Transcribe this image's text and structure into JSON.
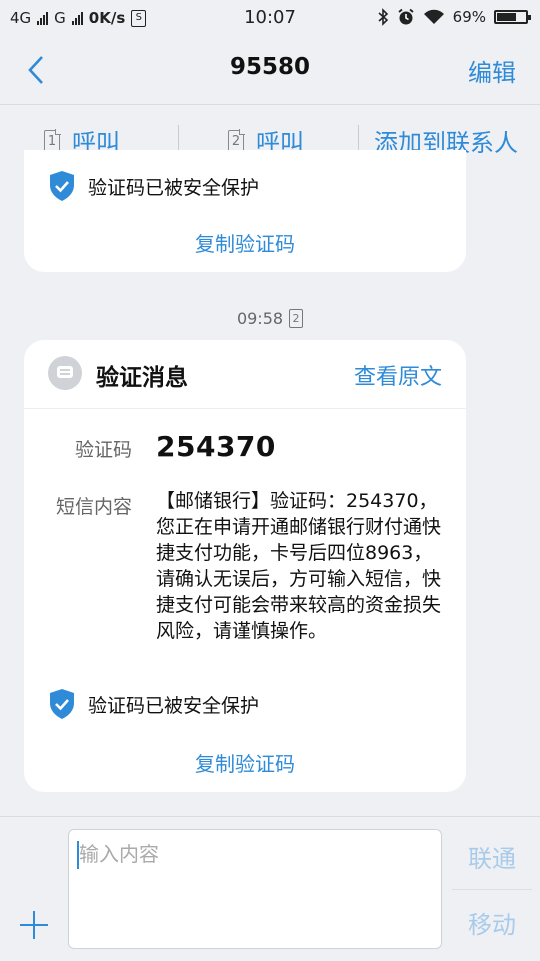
{
  "status_bar": {
    "net1": "4G",
    "net2": "G",
    "speed": "0K/s",
    "time": "10:07",
    "battery": "69%",
    "battery_level": 0.69
  },
  "header": {
    "title": "95580",
    "edit_label": "编辑"
  },
  "actions": {
    "call1_label": "呼叫",
    "call1_sim": "1",
    "call2_label": "呼叫",
    "call2_sim": "2",
    "add_contact_label": "添加到联系人"
  },
  "prev_message": {
    "protected_text": "验证码已被安全保护",
    "copy_label": "复制验证码"
  },
  "timestamp": {
    "time": "09:58",
    "sim": "2"
  },
  "verification_card": {
    "title": "验证消息",
    "view_original": "查看原文",
    "code_label": "验证码",
    "code_value": "254370",
    "content_label": "短信内容",
    "content": "【邮储银行】验证码：254370，您正在申请开通邮储银行财付通快捷支付功能，卡号后四位8963，请确认无误后，方可输入短信，快捷支付可能会带来较高的资金损失风险，请谨慎操作。",
    "protected_text": "验证码已被安全保护",
    "copy_label": "复制验证码"
  },
  "composer": {
    "placeholder": "输入内容",
    "send_unicom": "联通",
    "send_mobile": "移动"
  },
  "colors": {
    "accent": "#2f8bd8",
    "background": "#eef0f4",
    "card": "#ffffff",
    "disabled": "#a9cbea"
  }
}
